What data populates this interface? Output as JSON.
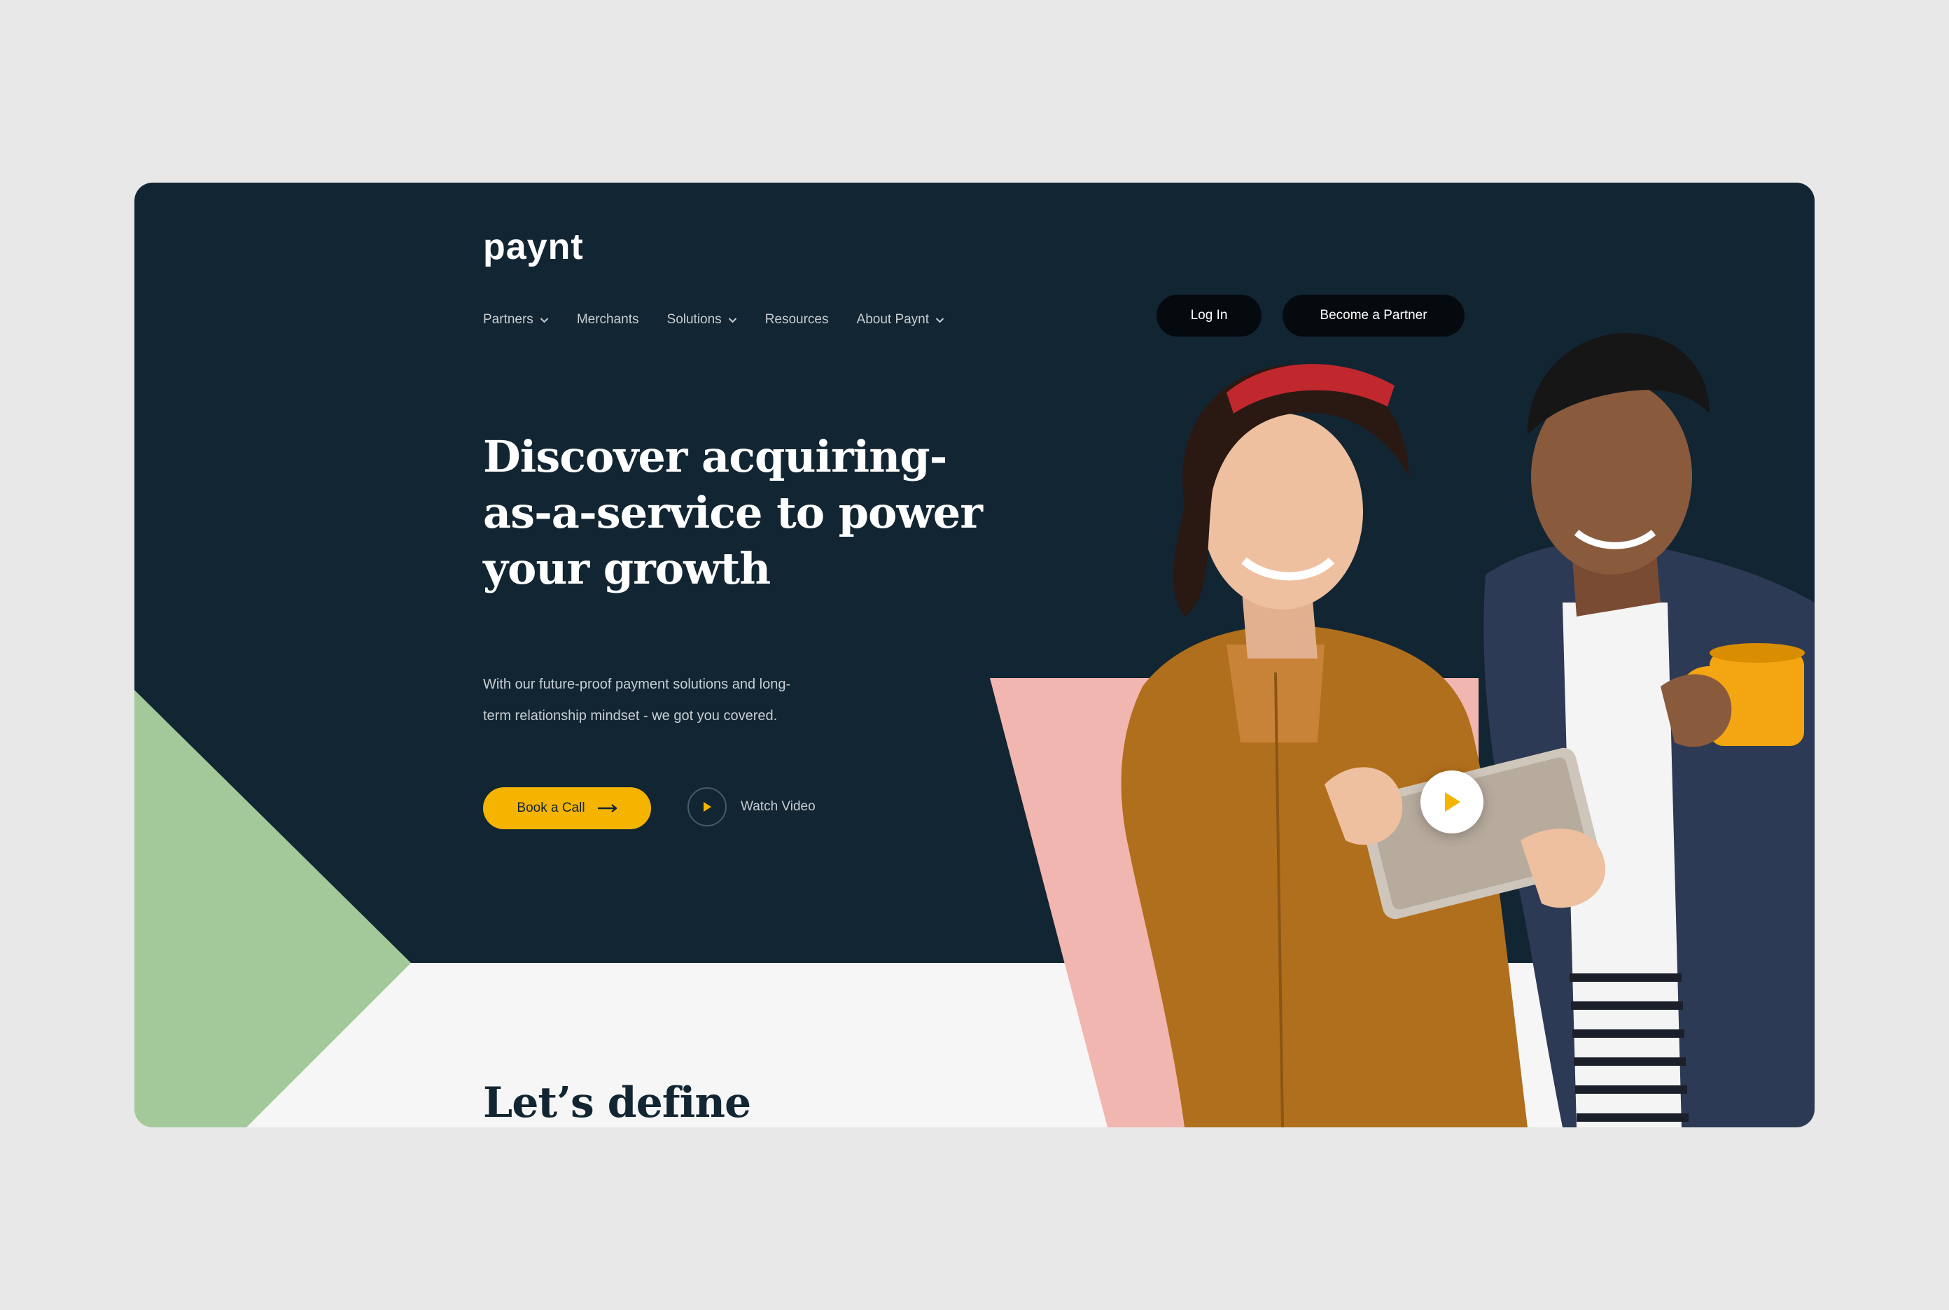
{
  "brand": {
    "logo_text": "paynt"
  },
  "nav": {
    "items": [
      {
        "label": "Partners",
        "has_dropdown": true
      },
      {
        "label": "Merchants",
        "has_dropdown": false
      },
      {
        "label": "Solutions",
        "has_dropdown": true
      },
      {
        "label": "Resources",
        "has_dropdown": false
      },
      {
        "label": "About Paynt",
        "has_dropdown": true
      }
    ],
    "login_label": "Log In",
    "partner_label": "Become a Partner"
  },
  "hero": {
    "headline": "Discover acquiring-as-a-service to power your growth",
    "subtext": "With our future-proof payment solutions and long-term relationship mindset - we got you covered.",
    "primary_cta": "Book a Call",
    "secondary_cta": "Watch Video"
  },
  "next_section": {
    "title": "Let’s define"
  },
  "icons": {
    "chevron": "chevron-down-icon",
    "arrow": "arrow-right-icon",
    "play": "play-icon"
  },
  "colors": {
    "hero_background": "#122532",
    "accent_yellow": "#f5b400",
    "accent_green": "#a3c99a",
    "accent_pink": "#f2b6b0",
    "section_background": "#f6f6f6"
  }
}
